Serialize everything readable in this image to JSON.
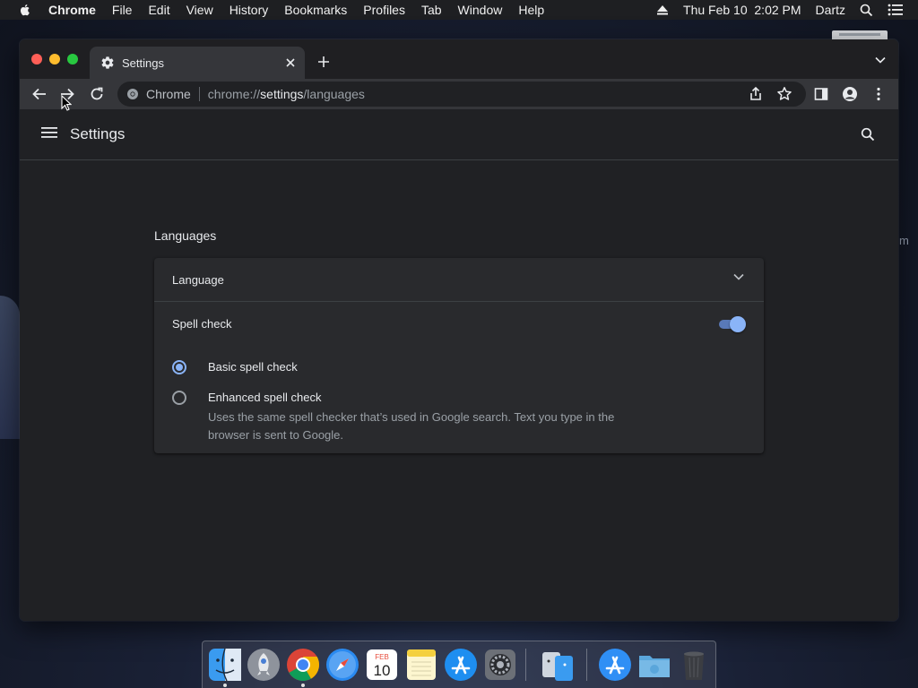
{
  "menubar": {
    "app_name": "Chrome",
    "items": [
      "File",
      "Edit",
      "View",
      "History",
      "Bookmarks",
      "Profiles",
      "Tab",
      "Window",
      "Help"
    ],
    "clock": "Thu Feb 10  2:02 PM",
    "user": "Dartz"
  },
  "desktop": {
    "partial_label": "m"
  },
  "browser": {
    "tab_title": "Settings",
    "omnibox": {
      "site_name": "Chrome",
      "url_scheme": "chrome://",
      "url_host": "settings",
      "url_path": "/languages"
    }
  },
  "settings": {
    "header_title": "Settings",
    "section_title": "Languages",
    "language_row_label": "Language",
    "spell_check_label": "Spell check",
    "spell_check_enabled": true,
    "options": [
      {
        "label": "Basic spell check",
        "selected": true
      },
      {
        "label": "Enhanced spell check",
        "selected": false,
        "description": "Uses the same spell checker that’s used in Google search. Text you type in the browser is sent to Google."
      }
    ]
  },
  "dock": {
    "apps": [
      "finder-icon",
      "launchpad-icon",
      "chrome-icon",
      "safari-icon",
      "calendar-icon",
      "notes-icon",
      "app-store-icon",
      "system-preferences-icon",
      "migration-assistant-icon",
      "applications-folder-icon",
      "downloads-folder-icon",
      "trash-icon"
    ],
    "calendar_month": "FEB",
    "calendar_day": "10"
  },
  "colors": {
    "accent": "#8ab4f8",
    "page_bg": "#202124",
    "card_bg": "#292a2d"
  }
}
